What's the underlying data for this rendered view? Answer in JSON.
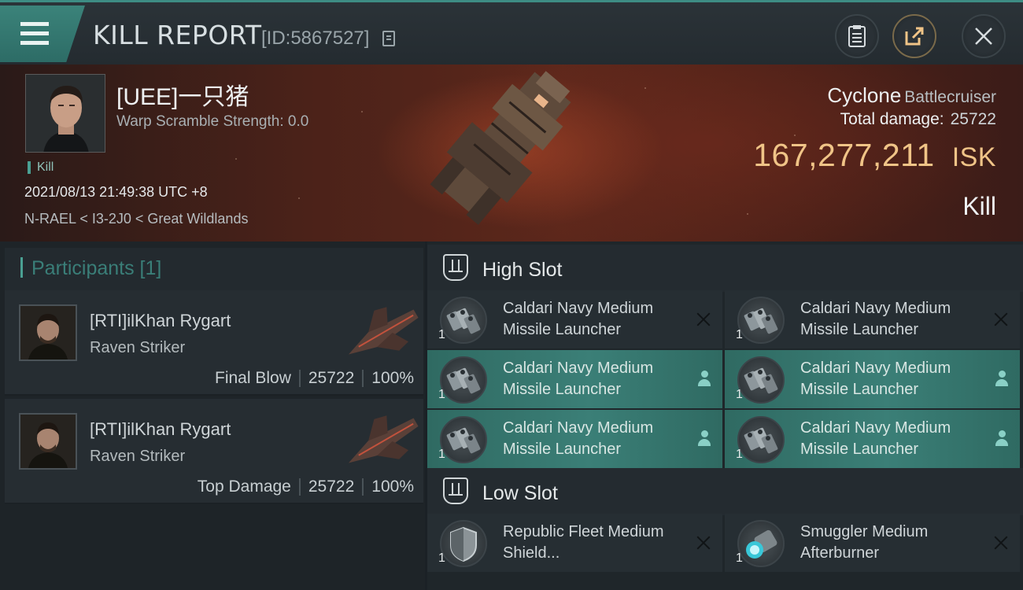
{
  "header": {
    "title": "KILL REPORT",
    "report_id": "[ID:5867527]",
    "icons": [
      "menu-icon",
      "copy-icon",
      "clipboard-icon",
      "share-icon",
      "close-icon"
    ]
  },
  "victim": {
    "name": "[UEE]一只猪",
    "warp_scramble": "Warp Scramble Strength: 0.0",
    "tag": "Kill",
    "datetime": "2021/08/13 21:49:38 UTC +8",
    "location": "N-RAEL < I3-2J0 < Great Wildlands"
  },
  "ship": {
    "name": "Cyclone",
    "class": "Battlecruiser",
    "total_damage_label": "Total damage:",
    "total_damage": "25722",
    "isk_value": "167,277,211",
    "isk_unit": "ISK",
    "outcome": "Kill"
  },
  "participants": {
    "title": "Participants [1]",
    "list": [
      {
        "name": "[RTI]ilKhan Rygart",
        "ship": "Raven Striker",
        "role": "Final Blow",
        "damage": "25722",
        "percent": "100%"
      },
      {
        "name": "[RTI]ilKhan Rygart",
        "ship": "Raven Striker",
        "role": "Top Damage",
        "damage": "25722",
        "percent": "100%"
      }
    ]
  },
  "slots": {
    "high_label": "High Slot",
    "low_label": "Low Slot",
    "high_items": [
      {
        "name": "Caldari Navy Medium Missile Launcher",
        "qty": "1",
        "state": "destroyed"
      },
      {
        "name": "Caldari Navy Medium Missile Launcher",
        "qty": "1",
        "state": "destroyed"
      },
      {
        "name": "Caldari Navy Medium Missile Launcher",
        "qty": "1",
        "state": "dropped"
      },
      {
        "name": "Caldari Navy Medium Missile Launcher",
        "qty": "1",
        "state": "dropped"
      },
      {
        "name": "Caldari Navy Medium Missile Launcher",
        "qty": "1",
        "state": "dropped"
      },
      {
        "name": "Caldari Navy Medium Missile Launcher",
        "qty": "1",
        "state": "dropped"
      }
    ],
    "low_items": [
      {
        "name": "Republic Fleet Medium Shield...",
        "qty": "1",
        "state": "destroyed"
      },
      {
        "name": "Smuggler Medium Afterburner",
        "qty": "1",
        "state": "destroyed"
      }
    ]
  },
  "colors": {
    "accent": "#3d8c84",
    "isk": "#f0c487",
    "dropped_row": "#3b7f77"
  }
}
